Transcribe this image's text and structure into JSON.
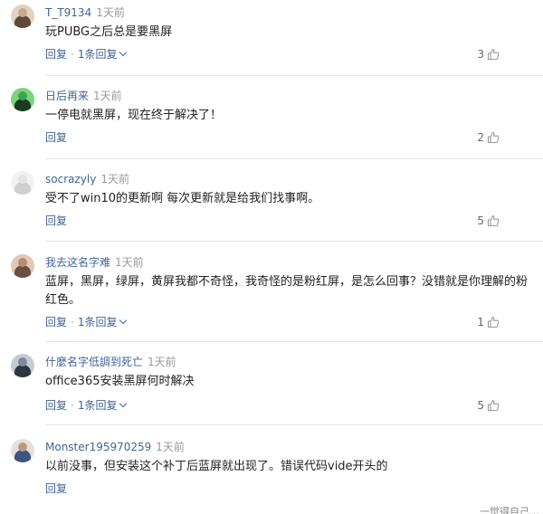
{
  "comments": [
    {
      "username": "T_T9134",
      "time": "1天前",
      "content": "玩PUBG之后总是要黑屏",
      "reply_label": "回复",
      "reply_count_label": "1条回复",
      "likes": "3",
      "avatar": {
        "colors": [
          "#5d4a3c",
          "#c9a98e",
          "#e5d2c1"
        ]
      }
    },
    {
      "username": "日后再来",
      "time": "1天前",
      "content": "一停电就黑屏，现在终于解决了！",
      "reply_label": "回复",
      "likes": "2",
      "avatar": {
        "colors": [
          "#1d3a22",
          "#3aa64c",
          "#7dd37e"
        ]
      }
    },
    {
      "username": "socrazyly",
      "time": "1天前",
      "content": "受不了win10的更新啊 每次更新就是给我们找事啊。",
      "reply_label": "回复",
      "likes": "5",
      "avatar": {
        "colors": [
          "#cfcfcf",
          "#e4e4e4",
          "#f2f2f2"
        ]
      }
    },
    {
      "username": "我去这名字难",
      "time": "1天前",
      "content": "蓝屏，黑屏，绿屏，黄屏我都不奇怪，我奇怪的是粉红屏，是怎么回事？没错就是你理解的粉红色。",
      "reply_label": "回复",
      "reply_count_label": "1条回复",
      "likes": "1",
      "avatar": {
        "colors": [
          "#6a5040",
          "#b48d72",
          "#e0c9b5"
        ]
      }
    },
    {
      "username": "什麼名字低調到死亡",
      "time": "1天前",
      "content": "office365安装黑屏何时解决",
      "reply_label": "回复",
      "reply_count_label": "1条回复",
      "likes": "5",
      "avatar": {
        "colors": [
          "#2c3540",
          "#7d8a96",
          "#c4ccd3"
        ]
      }
    },
    {
      "username": "Monster195970259",
      "time": "1天前",
      "content": "以前没事，但安装这个补丁后蓝屏就出现了。错误代码vide开头的",
      "reply_label": "回复",
      "likes": "",
      "avatar": {
        "colors": [
          "#3d5580",
          "#b79a86",
          "#e8e0d8"
        ]
      }
    }
  ],
  "footer_cutoff_text": "一觉得自己…",
  "colors": {
    "link": "#406599",
    "muted": "#999999",
    "text": "#222222"
  }
}
